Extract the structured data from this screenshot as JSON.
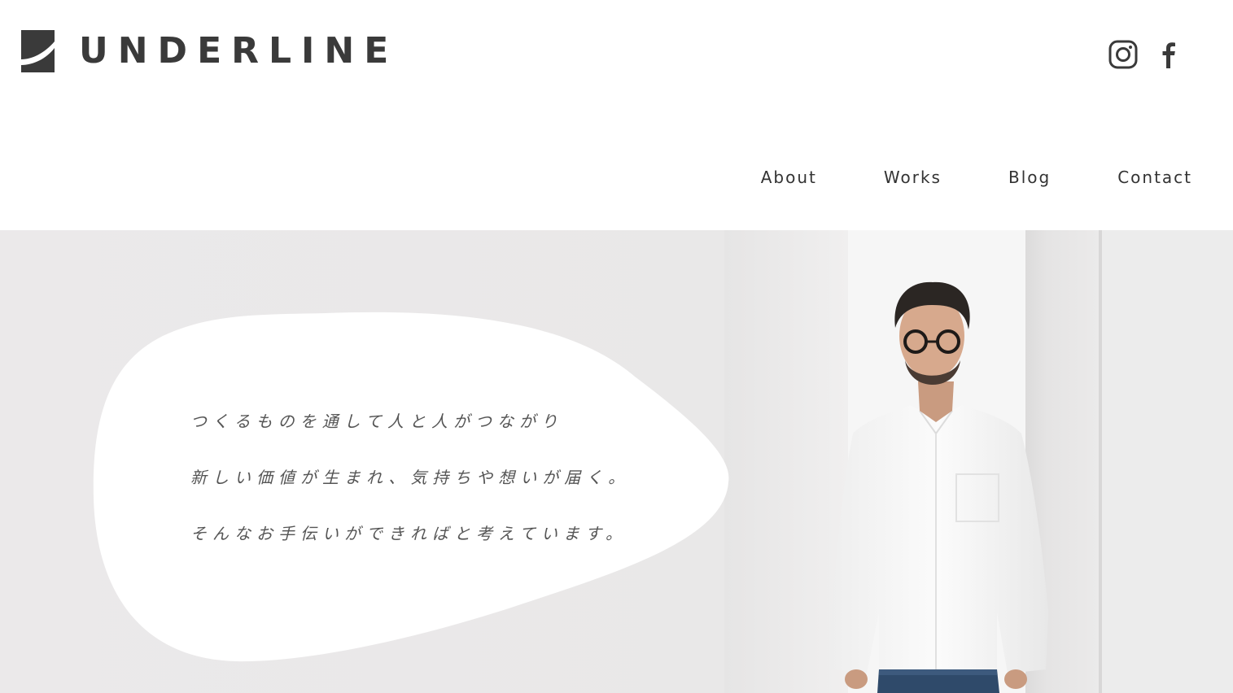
{
  "brand": {
    "name": "UNDERLINE",
    "mark_icon": "underline-logo-mark",
    "color": "#3a3a3a"
  },
  "social": {
    "instagram_icon": "instagram-icon",
    "facebook_icon": "facebook-icon"
  },
  "nav": {
    "items": [
      {
        "label": "About"
      },
      {
        "label": "Works"
      },
      {
        "label": "Blog"
      },
      {
        "label": "Contact"
      }
    ]
  },
  "hero": {
    "background": "#edebec",
    "lines": [
      "つくるものを通して人と人がつながり",
      "新しい価値が生まれ、気持ちや想いが届く。",
      "そんなお手伝いができればと考えています。"
    ]
  }
}
